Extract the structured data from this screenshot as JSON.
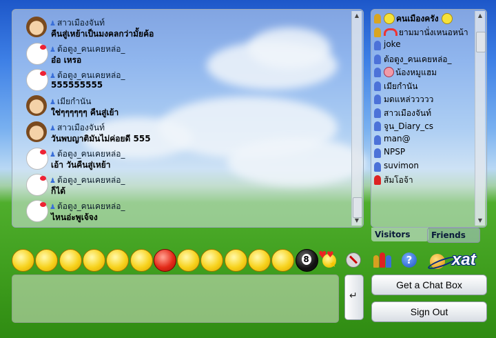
{
  "chat": {
    "messages": [
      {
        "name": "สาวเมืองจันท์",
        "text": "คืนสู่เหย้าเป็นมงคลกว่ามั้ยค้อ",
        "avatar": "girl"
      },
      {
        "name": "ต้อตูง_คนเคยหล่อ_",
        "text": "อ๋อ เหรอ",
        "avatar": "kitty"
      },
      {
        "name": "ต้อตูง_คนเคยหล่อ_",
        "text": "555555555",
        "avatar": "kitty"
      },
      {
        "name": "เมียกำนัน",
        "text": "ใช่ๆๆๆๆๆๆ คืนสู่เย้า",
        "avatar": "girl"
      },
      {
        "name": "สาวเมืองจันท์",
        "text": "วันพบญาติมันไม่ค่อยดี 555",
        "avatar": "girl"
      },
      {
        "name": "ต้อตูง_คนเคยหล่อ_",
        "text": "เอ้า วันคืนสู่เหย้า",
        "avatar": "kitty"
      },
      {
        "name": "ต้อตูง_คนเคยหล่อ_",
        "text": "ก็ได้",
        "avatar": "kitty"
      },
      {
        "name": "ต้อตูง_คนเคยหล่อ_",
        "text": "ไหนอ่ะพูเจ้จง",
        "avatar": "kitty"
      }
    ],
    "input_value": "",
    "send_icon": "return-arrow-icon"
  },
  "users": [
    {
      "name": "คนเมืองครัง",
      "icon": "gold",
      "bold": true,
      "smileys": 2
    },
    {
      "name": "ยามมานั่งเหนอหน้า",
      "icon": "gold",
      "rainbow": true
    },
    {
      "name": "joke",
      "icon": "blue"
    },
    {
      "name": "ต้อตูง_คนเคยหล่อ_",
      "icon": "blue"
    },
    {
      "name": "น้องหมูแฮม",
      "icon": "blue",
      "pig": true
    },
    {
      "name": "เมียกำนัน",
      "icon": "blue"
    },
    {
      "name": "มดแหล่ววววว",
      "icon": "blue"
    },
    {
      "name": "สาวเมืองจันท์",
      "icon": "blue"
    },
    {
      "name": "จูน_Diary_cs",
      "icon": "blue"
    },
    {
      "name": "man@",
      "icon": "blue"
    },
    {
      "name": "NPSP",
      "icon": "blue"
    },
    {
      "name": "suvimon",
      "icon": "blue"
    },
    {
      "name": "ส้มโอจ้า",
      "icon": "red"
    }
  ],
  "tabs": {
    "visitors": "Visitors",
    "friends": "Friends"
  },
  "buttons": {
    "get_chat_box": "Get a Chat Box",
    "sign_out": "Sign Out"
  },
  "brand": {
    "name": "xat"
  },
  "emoticons": [
    "smile",
    "biggrin",
    "wink",
    "eek",
    "tongue",
    "cool",
    "mad",
    "confused",
    "redface",
    "frown",
    "crying",
    "yum",
    "8ball",
    "sweetheart"
  ],
  "colors": {
    "accent": "#1d57c9",
    "grass": "#3f9e1e"
  }
}
